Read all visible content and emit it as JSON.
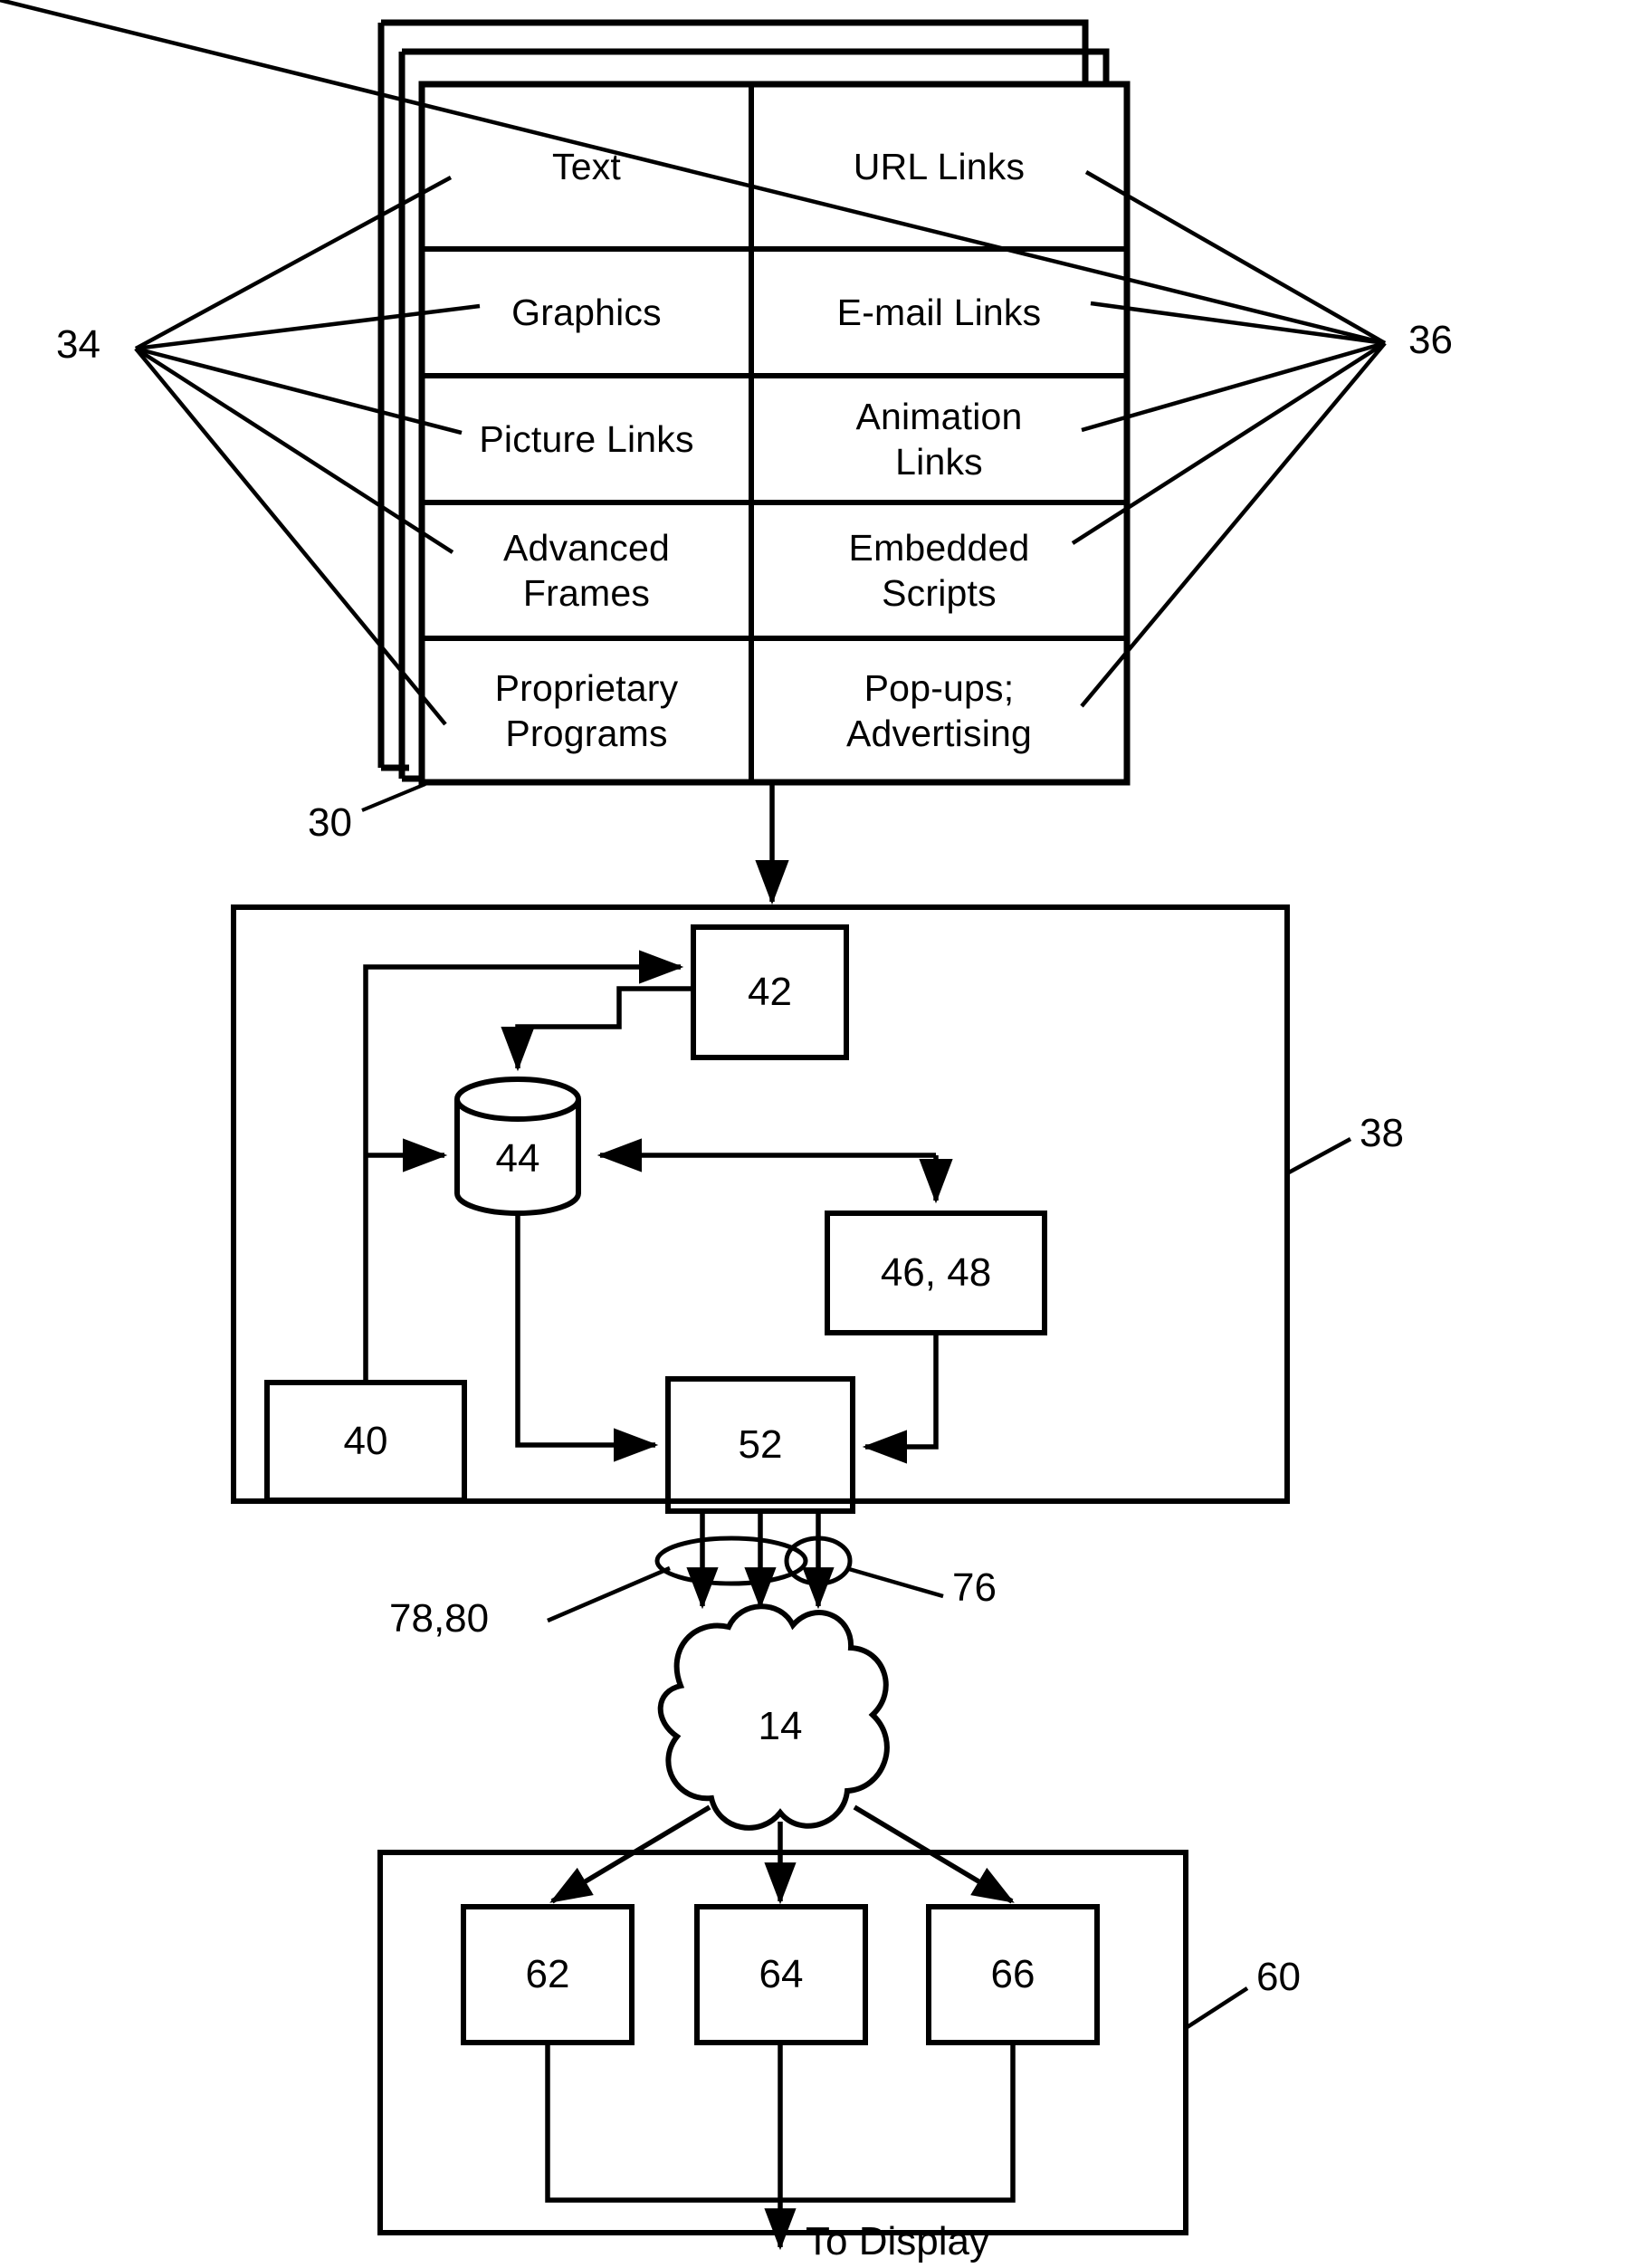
{
  "figure": {
    "type": "patent-block-diagram",
    "background": "#ffffff",
    "ink": "#000000"
  },
  "content_table": {
    "reference_left": "34",
    "reference_right": "36",
    "reference_stack": "30",
    "rows": [
      {
        "left": "Text",
        "right": "URL Links"
      },
      {
        "left": "Graphics",
        "right": "E-mail Links"
      },
      {
        "left": "Picture Links",
        "right": "Animation\nLinks"
      },
      {
        "left": "Advanced\nFrames",
        "right": "Embedded\nScripts"
      },
      {
        "left": "Proprietary\nPrograms",
        "right": "Pop-ups;\nAdvertising"
      }
    ]
  },
  "server_block": {
    "reference": "38",
    "nodes": [
      {
        "id": "n42",
        "label": "42",
        "shape": "rect"
      },
      {
        "id": "n44",
        "label": "44",
        "shape": "cylinder"
      },
      {
        "id": "n46",
        "label": "46, 48",
        "shape": "rect"
      },
      {
        "id": "n40",
        "label": "40",
        "shape": "rect"
      },
      {
        "id": "n52",
        "label": "52",
        "shape": "rect"
      }
    ]
  },
  "network": {
    "cloud_label": "14",
    "ellipse_group_label": "78,80",
    "ellipse_single_label": "76"
  },
  "client_block": {
    "reference": "60",
    "nodes": [
      {
        "id": "n62",
        "label": "62"
      },
      {
        "id": "n64",
        "label": "64"
      },
      {
        "id": "n66",
        "label": "66"
      }
    ],
    "output_label": "To Display"
  }
}
